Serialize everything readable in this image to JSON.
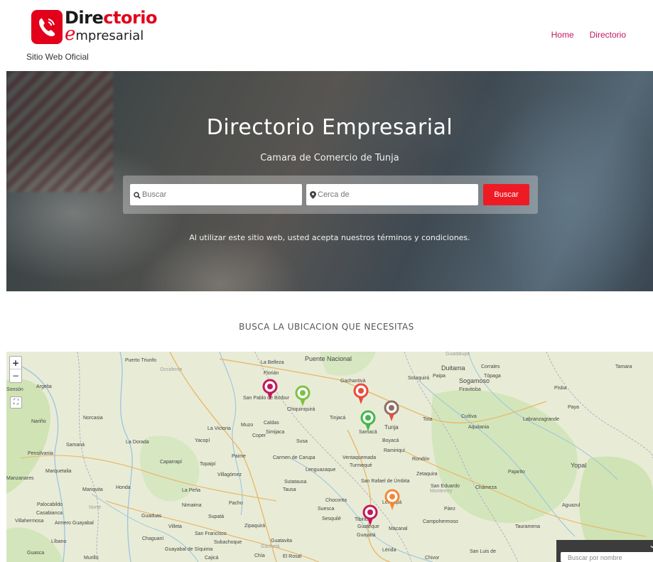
{
  "header": {
    "logo_word_dark": "Dire",
    "logo_word_red": "ctorio",
    "logo_line2_e": "e",
    "logo_line2_rest": "mpresarial",
    "tagline": "Sitio Web Oficial",
    "nav": [
      {
        "label": "Home"
      },
      {
        "label": "Directorio"
      }
    ]
  },
  "hero": {
    "title": "Directorio Empresarial",
    "subtitle": "Camara de Comercio de Tunja",
    "search_placeholder": "Buscar",
    "near_placeholder": "Cerca de",
    "search_button": "Buscar",
    "terms": "Al utilizar este sitio web, usted acepta nuestros términos y condiciones."
  },
  "section": {
    "title": "BUSCA LA UBICACION QUE NECESITAS"
  },
  "map": {
    "zoom_in": "+",
    "zoom_out": "−",
    "labels": [
      "Puerto Triunfo",
      "Occidente",
      "La Belleza",
      "Florián",
      "Puente Nacional",
      "Guadalupe",
      "Duitama",
      "Corrales",
      "Tópaga",
      "Tamara",
      "Argelia",
      "Sonsón",
      "Nariño",
      "Norcasia",
      "La Victoria",
      "Muzo",
      "Coper",
      "Caldas",
      "Simijaca",
      "Susa",
      "Tinjacá",
      "Samacá",
      "Tunja",
      "Boyacá",
      "Chiquinquirá",
      "San Pablo de Borbur",
      "Gachantivá",
      "Sotaquirá",
      "Paipa",
      "Sogamoso",
      "Firavitoba",
      "Pisba",
      "Paya",
      "Tota",
      "Cuítiva",
      "Aquitania",
      "Labranzagrande",
      "Samaná",
      "Pensilvania",
      "La Dorada",
      "Yacopí",
      "Paime",
      "Carmen de Carupa",
      "Ventaquemada",
      "Turmequé",
      "Ramiriquí",
      "Rondón",
      "Marquetalia",
      "Manzanares",
      "Caparrapí",
      "Topaipí",
      "Villagómez",
      "Lenguazaque",
      "Zetaquira",
      "Pajarito",
      "Yopal",
      "Mariquita",
      "Honda",
      "La Peña",
      "Sutatausa",
      "Tausa",
      "San Rafael de Úmbita",
      "San Eduardo",
      "Chámeza",
      "Palocabildo",
      "Norte",
      "Casabianca",
      "Villahermosa",
      "Armero Guayabal",
      "Guaduas",
      "Nimaima",
      "Pacho",
      "Choconta",
      "Suesca",
      "Sesquilé",
      "Tibirita",
      "Guateque",
      "Guayatá",
      "Páez",
      "Campohermoso",
      "Aguazul",
      "Macanal",
      "Tauramena",
      "Villeta",
      "Supatá",
      "Zipaquirá",
      "San Francisco",
      "Chaguaní",
      "Líbano",
      "Subachoque",
      "Gachetá",
      "Guatavita",
      "Guayabal de Síquima",
      "Chía",
      "Cajicá",
      "El Rosal",
      "Guasca",
      "Murillo",
      "Lérida",
      "Chivor",
      "San Luis de",
      "Monterrey",
      "Lengupá",
      "Pachavita"
    ],
    "search_panel_placeholder": "Buscar por nombre"
  },
  "colors": {
    "brand_red": "#e3001b",
    "nav_pink": "#c2185b",
    "button_red": "#ee1b24"
  }
}
